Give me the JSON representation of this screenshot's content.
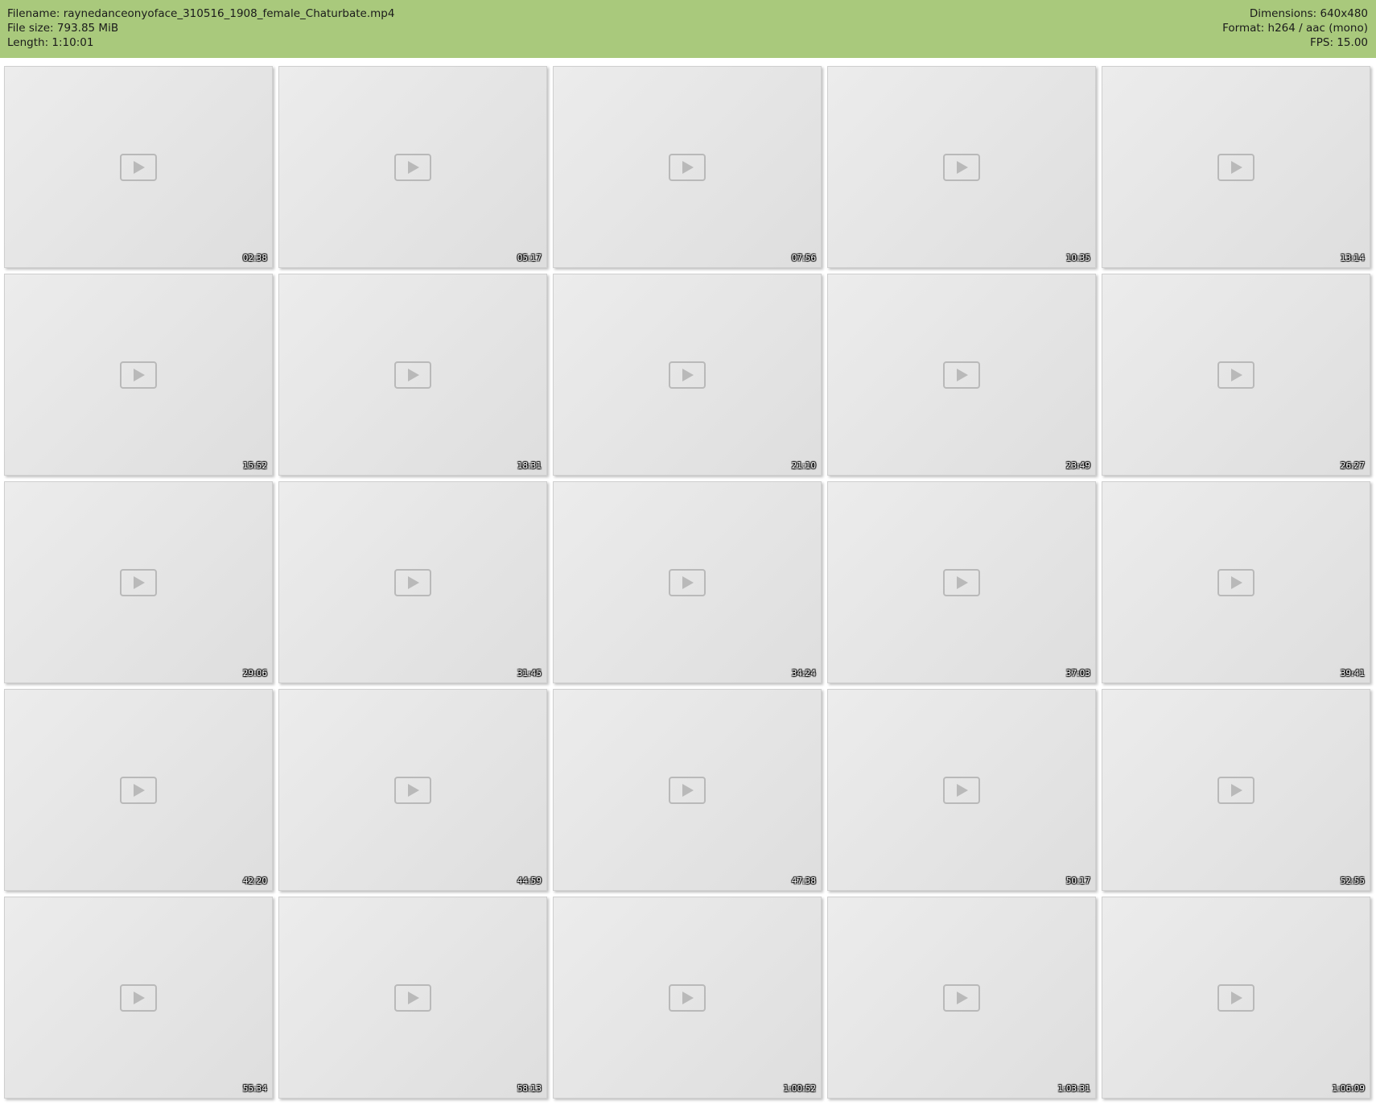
{
  "header": {
    "filename": "Filename: raynedanceonyoface_310516_1908_female_Chaturbate.mp4",
    "file_size": "File size: 793.85 MiB",
    "length": "Length: 1:10:01",
    "dimensions": "Dimensions: 640x480",
    "format": "Format: h264 / aac (mono)",
    "fps": "FPS: 15.00"
  },
  "colors": {
    "header_background": "#a9c97c",
    "page_background": "#ffffff"
  },
  "frames": [
    {
      "timestamp": "02:38"
    },
    {
      "timestamp": "05:17"
    },
    {
      "timestamp": "07:56"
    },
    {
      "timestamp": "10:35"
    },
    {
      "timestamp": "13:14"
    },
    {
      "timestamp": "15:52"
    },
    {
      "timestamp": "18:31"
    },
    {
      "timestamp": "21:10"
    },
    {
      "timestamp": "23:49"
    },
    {
      "timestamp": "26:27"
    },
    {
      "timestamp": "29:06"
    },
    {
      "timestamp": "31:45"
    },
    {
      "timestamp": "34:24"
    },
    {
      "timestamp": "37:03"
    },
    {
      "timestamp": "39:41"
    },
    {
      "timestamp": "42:20"
    },
    {
      "timestamp": "44:59"
    },
    {
      "timestamp": "47:38"
    },
    {
      "timestamp": "50:17"
    },
    {
      "timestamp": "52:55"
    },
    {
      "timestamp": "55:34"
    },
    {
      "timestamp": "58:13"
    },
    {
      "timestamp": "1:00:52"
    },
    {
      "timestamp": "1:03:31"
    },
    {
      "timestamp": "1:06:09"
    }
  ]
}
